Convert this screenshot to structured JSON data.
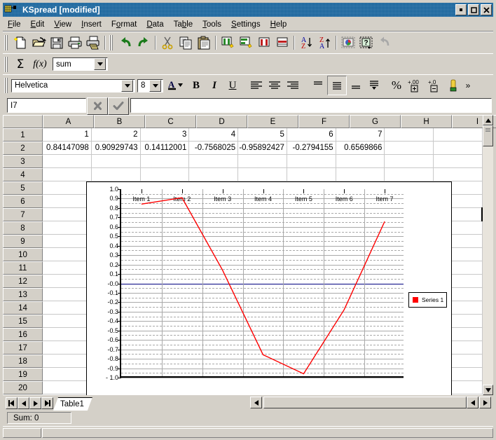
{
  "window": {
    "title": "KSpread [modified]",
    "icon": "kspread-app-icon",
    "buttons": {
      "minimize": "▪",
      "maximize": "◻",
      "close": "✖"
    }
  },
  "menu": [
    {
      "label": "File",
      "accel": "F"
    },
    {
      "label": "Edit",
      "accel": "E"
    },
    {
      "label": "View",
      "accel": "V"
    },
    {
      "label": "Insert",
      "accel": "I"
    },
    {
      "label": "Format",
      "accel": "o"
    },
    {
      "label": "Data",
      "accel": "D"
    },
    {
      "label": "Table",
      "accel": "b"
    },
    {
      "label": "Tools",
      "accel": "T"
    },
    {
      "label": "Settings",
      "accel": "S"
    },
    {
      "label": "Help",
      "accel": "H"
    }
  ],
  "toolbar_main": [
    {
      "name": "new-document-icon",
      "title": "New"
    },
    {
      "name": "open-document-icon",
      "title": "Open"
    },
    {
      "name": "save-document-icon",
      "title": "Save"
    },
    {
      "name": "print-icon",
      "title": "Print"
    },
    {
      "name": "print-preview-icon",
      "title": "Print Preview"
    },
    {
      "name": "undo-icon",
      "title": "Undo"
    },
    {
      "name": "redo-icon",
      "title": "Redo"
    },
    {
      "name": "cut-icon",
      "title": "Cut"
    },
    {
      "name": "copy-icon",
      "title": "Copy"
    },
    {
      "name": "paste-icon",
      "title": "Paste"
    },
    {
      "name": "insert-column-icon",
      "title": "Insert Column"
    },
    {
      "name": "insert-row-icon",
      "title": "Insert Row"
    },
    {
      "name": "delete-column-icon",
      "title": "Delete Column"
    },
    {
      "name": "delete-row-icon",
      "title": "Delete Row"
    },
    {
      "name": "sort-ascending-icon",
      "title": "Sort Increasing"
    },
    {
      "name": "sort-descending-icon",
      "title": "Sort Decreasing"
    },
    {
      "name": "insert-chart-icon",
      "title": "Insert Chart"
    },
    {
      "name": "insert-object-icon",
      "title": "Insert Object"
    },
    {
      "name": "whats-this-icon",
      "title": "What's This?"
    }
  ],
  "toolbar_formula": {
    "sum_icon": "sum-sigma-icon",
    "function_icon": "function-fx-icon",
    "function_selected": "sum"
  },
  "toolbar_format": {
    "font_name": "Helvetica",
    "font_size": "8",
    "text_color_icon": "text-color-icon",
    "bold_label": "B",
    "italic_label": "I",
    "underline_label": "U",
    "align_left_icon": "align-left-icon",
    "align_center_icon": "align-center-icon",
    "align_right_icon": "align-right-icon",
    "valign_top_icon": "align-top-icon",
    "valign_middle_icon": "align-middle-icon",
    "valign_bottom_icon": "align-bottom-icon",
    "wrap_text_icon": "wrap-text-icon",
    "percent_label": "%",
    "add_decimal_icon": "add-decimal-icon",
    "remove_decimal_icon": "remove-decimal-icon",
    "money_icon": "money-format-icon",
    "more_label": "»"
  },
  "formula_bar": {
    "cell_reference": "I7",
    "cancel_icon": "cancel-x-icon",
    "accept_icon": "accept-check-icon",
    "formula_value": ""
  },
  "sheet": {
    "columns": [
      "A",
      "B",
      "C",
      "D",
      "E",
      "F",
      "G",
      "H",
      "I"
    ],
    "rows": [
      "1",
      "2",
      "3",
      "4",
      "5",
      "6",
      "7",
      "8",
      "9",
      "10",
      "11",
      "12",
      "13",
      "14",
      "15",
      "16",
      "17",
      "18",
      "19",
      "20"
    ],
    "data": [
      [
        "1",
        "2",
        "3",
        "4",
        "5",
        "6",
        "7",
        "",
        ""
      ],
      [
        "0.84147098",
        "0.90929743",
        "0.14112001",
        "-0.7568025",
        "-0.95892427",
        "-0.2794155",
        "0.6569866",
        "",
        ""
      ]
    ],
    "selected_cell": "I7"
  },
  "chart_data": {
    "type": "line",
    "title": "",
    "xlabel": "",
    "ylabel": "",
    "categories": [
      "Item 1",
      "Item 2",
      "Item 3",
      "Item 4",
      "Item 5",
      "Item 6",
      "Item 7"
    ],
    "series": [
      {
        "name": "Series 1",
        "color": "#ff0000",
        "values": [
          0.84147098,
          0.90929743,
          0.14112001,
          -0.7568025,
          -0.95892427,
          -0.2794155,
          0.6569866
        ]
      }
    ],
    "ylim": [
      -1.0,
      1.0
    ],
    "ytick_labels": [
      "1.0",
      "0.9",
      "0.8",
      "0.7",
      "0.6",
      "0.5",
      "0.4",
      "0.3",
      "0.2",
      "0.1",
      "-0.0",
      "-0.1",
      "-0.2",
      "-0.3",
      "-0.4",
      "-0.5",
      "-0.6",
      "-0.7",
      "-0.8",
      "-0.9",
      "- 1.0"
    ],
    "ytick_values": [
      1.0,
      0.9,
      0.8,
      0.7,
      0.6,
      0.5,
      0.4,
      0.3,
      0.2,
      0.1,
      0.0,
      -0.1,
      -0.2,
      -0.3,
      -0.4,
      -0.5,
      -0.6,
      -0.7,
      -0.8,
      -0.9,
      -1.0
    ],
    "grid": true,
    "zero_line_color": "#000080",
    "legend_position": "right",
    "legend_entries": [
      "Series 1"
    ]
  },
  "tabs": {
    "nav_first": "first-sheet-icon",
    "nav_prev": "previous-sheet-icon",
    "nav_next": "next-sheet-icon",
    "nav_last": "last-sheet-icon",
    "sheets": [
      "Table1"
    ],
    "active_sheet": "Table1"
  },
  "status": {
    "sum_label": "Sum: 0"
  }
}
